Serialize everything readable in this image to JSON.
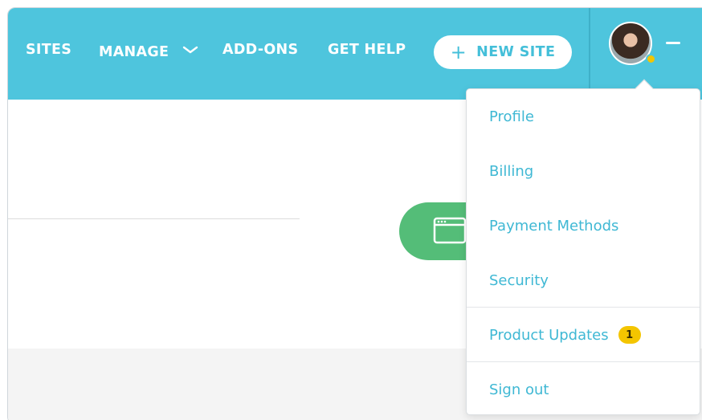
{
  "nav": {
    "sites_label": "SITES",
    "manage_label": "MANAGE",
    "addons_label": "ADD-ONS",
    "help_label": "GET HELP",
    "new_site_label": "NEW SITE",
    "new_site_icon": "plus-icon",
    "manage_icon": "chevron-down-icon"
  },
  "user": {
    "avatar_icon": "avatar",
    "status_color": "#f4c500",
    "menu_toggle_icon": "minus-icon"
  },
  "dropdown": {
    "items": [
      {
        "label": "Profile"
      },
      {
        "label": "Billing"
      },
      {
        "label": "Payment Methods"
      },
      {
        "label": "Security"
      },
      {
        "label": "Product Updates",
        "badge": "1"
      },
      {
        "label": "Sign out"
      }
    ]
  },
  "colors": {
    "header": "#4ec5dd",
    "accent_text": "#3fb8d4",
    "green_button": "#54bd78",
    "badge": "#f4c500"
  },
  "content": {
    "green_button_icon": "browser-window-icon"
  }
}
